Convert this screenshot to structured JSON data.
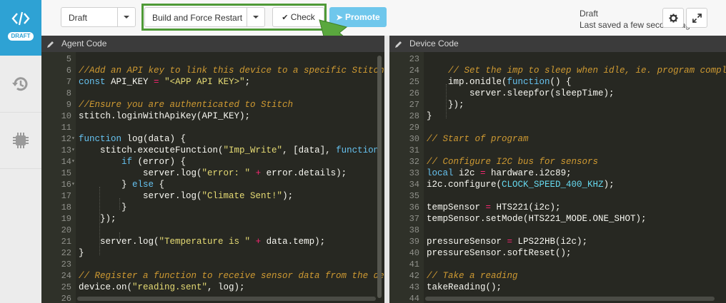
{
  "sidebar": {
    "logo_icon": "code-brackets-icon",
    "badge": "DRAFT",
    "items": [
      {
        "name": "history-icon"
      },
      {
        "name": "chip-icon"
      }
    ]
  },
  "toolbar": {
    "env_select": "Draft",
    "build_select": "Build and Force Restart",
    "check_label": "Check",
    "promote_label": "Promote",
    "status_title": "Draft",
    "status_saved": "Last saved a few seconds ago"
  },
  "agent": {
    "title": "Agent Code",
    "lines": [
      {
        "n": "5",
        "fold": "",
        "t": ""
      },
      {
        "n": "6",
        "fold": "",
        "t": "<span class=\"c\">//Add an API key to link this device to a specific Stitch U</span>"
      },
      {
        "n": "7",
        "fold": "",
        "t": "<span class=\"k\">const</span> API_KEY <span class=\"p\">=</span> <span class=\"s\">\"&lt;APP API KEY&gt;\"</span>;"
      },
      {
        "n": "8",
        "fold": "",
        "t": ""
      },
      {
        "n": "9",
        "fold": "",
        "t": "<span class=\"c\">//Ensure you are authenticated to Stitch</span>"
      },
      {
        "n": "10",
        "fold": "",
        "t": "stitch.loginWithApiKey(API_KEY);"
      },
      {
        "n": "11",
        "fold": "",
        "t": ""
      },
      {
        "n": "12",
        "fold": "▾",
        "t": "<span class=\"k\">function</span> log(data) {"
      },
      {
        "n": "13",
        "fold": "▾",
        "t": "    stitch.executeFunction(<span class=\"s\">\"Imp_Write\"</span>, [data], <span class=\"k\">function</span> (e"
      },
      {
        "n": "14",
        "fold": "▾",
        "t": "        <span class=\"k\">if</span> (error) {"
      },
      {
        "n": "15",
        "fold": "",
        "t": "            server.log(<span class=\"s\">\"error: \"</span> <span class=\"p\">+</span> error.details);"
      },
      {
        "n": "16",
        "fold": "▾",
        "t": "        } <span class=\"k\">else</span> {"
      },
      {
        "n": "17",
        "fold": "",
        "t": "            server.log(<span class=\"s\">\"Climate Sent!\"</span>);"
      },
      {
        "n": "18",
        "fold": "",
        "t": "        }"
      },
      {
        "n": "19",
        "fold": "",
        "t": "    });"
      },
      {
        "n": "20",
        "fold": "",
        "t": ""
      },
      {
        "n": "21",
        "fold": "",
        "t": "    server.log(<span class=\"s\">\"Temperature is \"</span> <span class=\"p\">+</span> data.temp);"
      },
      {
        "n": "22",
        "fold": "",
        "t": "}"
      },
      {
        "n": "23",
        "fold": "",
        "t": ""
      },
      {
        "n": "24",
        "fold": "",
        "t": "<span class=\"c\">// Register a function to receive sensor data from the devi</span>"
      },
      {
        "n": "25",
        "fold": "",
        "t": "device.on(<span class=\"s\">\"reading.sent\"</span>, log);"
      },
      {
        "n": "26",
        "fold": "",
        "t": ""
      }
    ]
  },
  "device": {
    "title": "Device Code",
    "lines": [
      {
        "n": "23",
        "fold": "",
        "t": ""
      },
      {
        "n": "24",
        "fold": "",
        "t": "    <span class=\"c\">// Set the imp to sleep when idle, ie. program complet</span>"
      },
      {
        "n": "25",
        "fold": "",
        "t": "    imp.onidle(<span class=\"k\">function</span>() {"
      },
      {
        "n": "26",
        "fold": "",
        "t": "        server.sleepfor(sleepTime);"
      },
      {
        "n": "27",
        "fold": "",
        "t": "    });"
      },
      {
        "n": "28",
        "fold": "",
        "t": "}"
      },
      {
        "n": "29",
        "fold": "",
        "t": ""
      },
      {
        "n": "30",
        "fold": "",
        "t": "<span class=\"c\">// Start of program</span>"
      },
      {
        "n": "31",
        "fold": "",
        "t": ""
      },
      {
        "n": "32",
        "fold": "",
        "t": "<span class=\"c\">// Configure I2C bus for sensors</span>"
      },
      {
        "n": "33",
        "fold": "",
        "t": "<span class=\"k\">local</span> i2c <span class=\"p\">=</span> hardware.i2c89;"
      },
      {
        "n": "34",
        "fold": "",
        "t": "i2c.configure(<span class=\"cons\">CLOCK_SPEED_400_KHZ</span>);"
      },
      {
        "n": "35",
        "fold": "",
        "t": ""
      },
      {
        "n": "36",
        "fold": "",
        "t": "tempSensor <span class=\"p\">=</span> HTS221(i2c);"
      },
      {
        "n": "37",
        "fold": "",
        "t": "tempSensor.setMode(HTS221_MODE.ONE_SHOT);"
      },
      {
        "n": "38",
        "fold": "",
        "t": ""
      },
      {
        "n": "39",
        "fold": "",
        "t": "pressureSensor <span class=\"p\">=</span> LPS22HB(i2c);"
      },
      {
        "n": "40",
        "fold": "",
        "t": "pressureSensor.softReset();"
      },
      {
        "n": "41",
        "fold": "",
        "t": ""
      },
      {
        "n": "42",
        "fold": "",
        "t": "<span class=\"c\">// Take a reading</span>"
      },
      {
        "n": "43",
        "fold": "",
        "t": "takeReading();"
      },
      {
        "n": "44",
        "fold": "",
        "t": ""
      }
    ]
  },
  "icons": {
    "check": "checkmark-icon",
    "promote": "promote-icon",
    "settings": "gear-icon",
    "expand": "expand-icon",
    "edit": "pencil-icon"
  }
}
